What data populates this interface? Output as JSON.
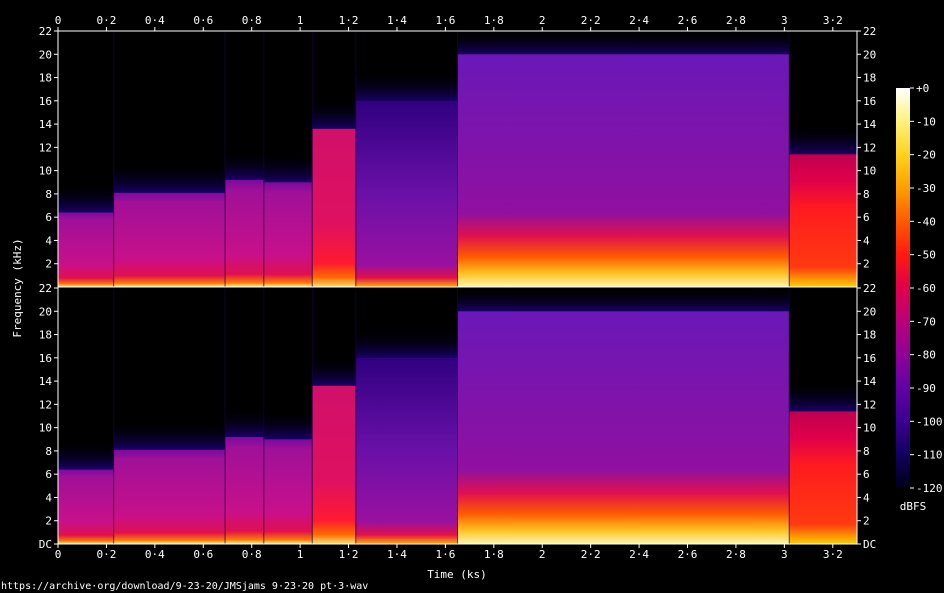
{
  "source_url": "https://archive·org/download/9-23-20/JMSjams 9·23·20 pt·3·wav",
  "colorbar": {
    "unit": "dBFS",
    "ticks": [
      "+0",
      "-10",
      "-20",
      "-30",
      "-40",
      "-50",
      "-60",
      "-70",
      "-80",
      "-90",
      "-100",
      "-110",
      "-120"
    ],
    "stops": [
      "#ffffff",
      "#fff27a",
      "#ffd21e",
      "#ff9f00",
      "#ff5a00",
      "#ff1a10",
      "#e0004a",
      "#b8007a",
      "#8f0097",
      "#6200a6",
      "#3a0090",
      "#12005e",
      "#000018"
    ]
  },
  "chart_data": {
    "type": "heatmap",
    "xlabel": "Time (ks)",
    "ylabel": "Frequency (kHz)",
    "xlim": [
      0,
      3.3
    ],
    "x_ticks": [
      "0",
      "0·2",
      "0·4",
      "0·6",
      "0·8",
      "1",
      "1·2",
      "1·4",
      "1·6",
      "1·8",
      "2",
      "2·2",
      "2·4",
      "2·6",
      "2·8",
      "3",
      "3·2"
    ],
    "x_tick_values": [
      0,
      0.2,
      0.4,
      0.6,
      0.8,
      1.0,
      1.2,
      1.4,
      1.6,
      1.8,
      2.0,
      2.2,
      2.4,
      2.6,
      2.8,
      3.0,
      3.2
    ],
    "ylim": [
      0,
      22
    ],
    "y_ticks_top": [
      "22",
      "20",
      "18",
      "16",
      "14",
      "12",
      "10",
      "8",
      "6",
      "4",
      "2"
    ],
    "y_ticks_bottom": [
      "22",
      "20",
      "18",
      "16",
      "14",
      "12",
      "10",
      "8",
      "6",
      "4",
      "2",
      "DC"
    ],
    "y_tick_values": [
      22,
      20,
      18,
      16,
      14,
      12,
      10,
      8,
      6,
      4,
      2,
      0
    ],
    "channels": 2,
    "segments": [
      {
        "t0": 0.0,
        "t1": 0.23,
        "cutoff_khz": 6.4,
        "style": "magenta"
      },
      {
        "t0": 0.23,
        "t1": 0.69,
        "cutoff_khz": 8.1,
        "style": "magenta"
      },
      {
        "t0": 0.69,
        "t1": 0.85,
        "cutoff_khz": 9.2,
        "style": "magenta"
      },
      {
        "t0": 0.85,
        "t1": 1.05,
        "cutoff_khz": 9.0,
        "style": "magenta"
      },
      {
        "t0": 1.05,
        "t1": 1.23,
        "cutoff_khz": 13.6,
        "style": "hotmagenta"
      },
      {
        "t0": 1.23,
        "t1": 1.65,
        "cutoff_khz": 16.0,
        "style": "violet"
      },
      {
        "t0": 1.65,
        "t1": 3.02,
        "cutoff_khz": 20.0,
        "style": "purple"
      },
      {
        "t0": 3.02,
        "t1": 3.3,
        "cutoff_khz": 11.4,
        "style": "red"
      }
    ]
  }
}
